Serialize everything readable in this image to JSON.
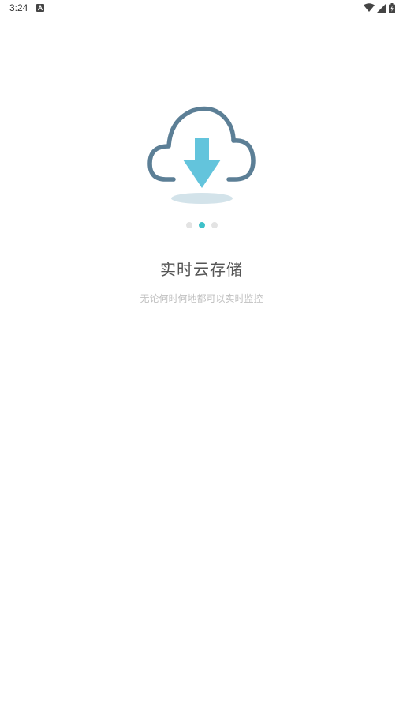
{
  "status_bar": {
    "time": "3:24",
    "notification_icon": "a-notification-icon",
    "wifi_icon": "wifi-icon",
    "signal_icon": "signal-icon",
    "battery_icon": "battery-charging-icon"
  },
  "onboarding": {
    "illustration_icon": "cloud-download-icon",
    "page_count": 3,
    "active_page": 2,
    "title": "实时云存储",
    "subtitle": "无论何时何地都可以实时监控"
  },
  "colors": {
    "cloud_outline": "#5c7f96",
    "arrow": "#63c4dc",
    "shadow": "#d3e3ea",
    "dot_active": "#3ec1c9",
    "dot_inactive": "#e3e3e3",
    "title": "#555555",
    "subtitle": "#c0c0c0"
  }
}
